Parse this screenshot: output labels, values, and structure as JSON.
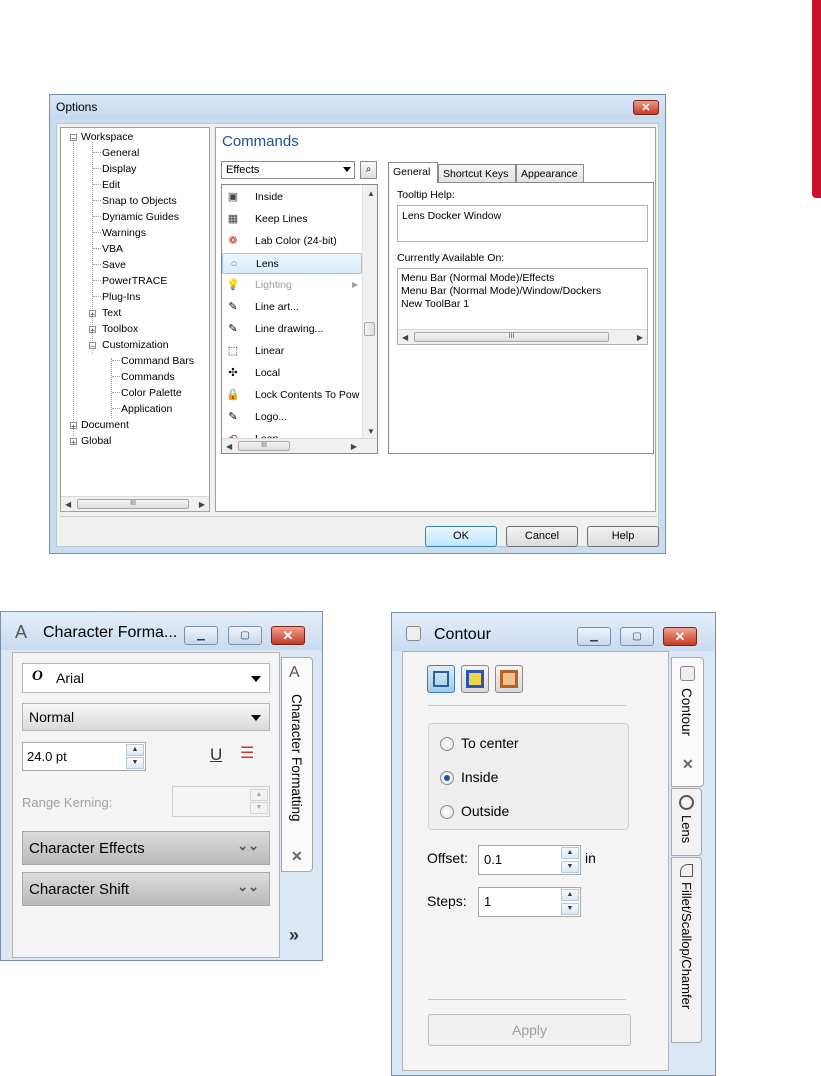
{
  "options_dialog": {
    "title": "Options",
    "close_glyph": "✕",
    "tree": {
      "root": "Workspace",
      "children": [
        "General",
        "Display",
        "Edit",
        "Snap to Objects",
        "Dynamic Guides",
        "Warnings",
        "VBA",
        "Save",
        "PowerTRACE",
        "Plug-Ins",
        "Text",
        "Toolbox",
        "Customization"
      ],
      "customization_children": [
        "Command Bars",
        "Commands",
        "Color Palette",
        "Application"
      ],
      "siblings": [
        "Document",
        "Global"
      ]
    },
    "section_title": "Commands",
    "category_select": "Effects",
    "find_icon": "binoculars-icon",
    "commands": [
      "Inside",
      "Keep Lines",
      "Lab Color (24-bit)",
      "Lens",
      "Lighting",
      "Line art...",
      "Line drawing...",
      "Linear",
      "Local",
      "Lock Contents To Pow",
      "Logo...",
      "Loop"
    ],
    "selected_command": "Lens",
    "disabled_command": "Lighting",
    "tabs": [
      "General",
      "Shortcut Keys",
      "Appearance"
    ],
    "active_tab": "General",
    "tooltip_help_label": "Tooltip Help:",
    "tooltip_help_value": "Lens Docker Window",
    "available_on_label": "Currently Available On:",
    "available_on": [
      "Menu Bar (Normal Mode)/Effects",
      "Menu Bar (Normal Mode)/Window/Dockers",
      "New ToolBar 1"
    ],
    "scroll_thumb_glyph": "III",
    "buttons": {
      "ok": "OK",
      "cancel": "Cancel",
      "help": "Help"
    }
  },
  "character_docker": {
    "title": "Character Forma...",
    "font": "Arial",
    "style": "Normal",
    "size": "24.0 pt",
    "range_kerning_label": "Range Kerning:",
    "sections": [
      "Character Effects",
      "Character Shift"
    ],
    "vertical_tab": "Character Formatting",
    "close_tab_glyph": "✕",
    "more_glyph": "»"
  },
  "contour_docker": {
    "title": "Contour",
    "options": [
      "To center",
      "Inside",
      "Outside"
    ],
    "selected_option": "Inside",
    "offset_label": "Offset:",
    "offset_value": "0.1",
    "offset_unit": "in",
    "steps_label": "Steps:",
    "steps_value": "1",
    "apply_label": "Apply",
    "vertical_tabs": [
      "Contour",
      "Lens",
      "Fillet/Scallop/Chamfer"
    ],
    "close_tab_glyph": "✕"
  },
  "colors": {
    "accent": "#1e4f9a",
    "brand_red": "#c8102e",
    "selection": "#d8ebfb"
  }
}
